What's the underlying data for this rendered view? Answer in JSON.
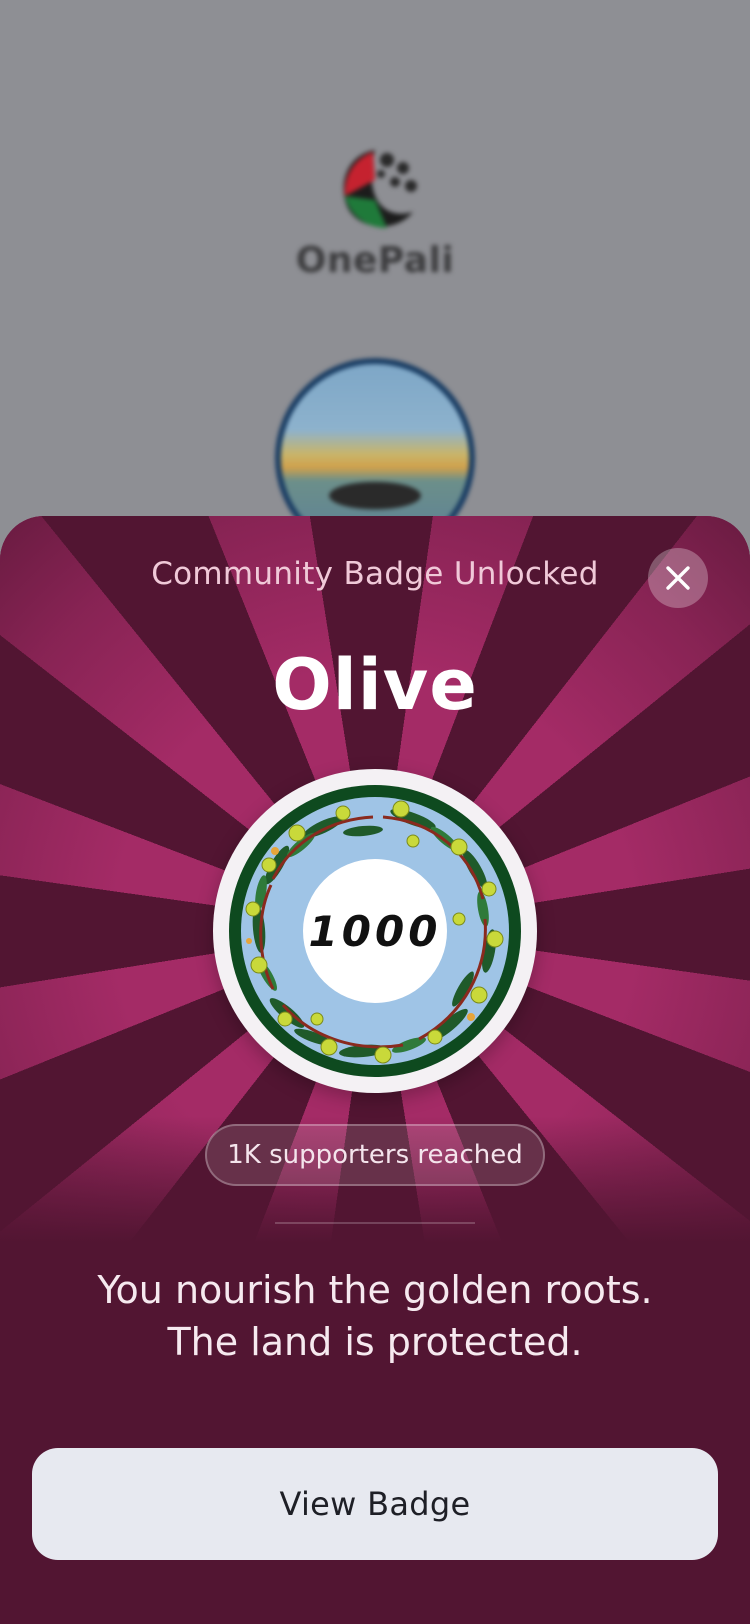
{
  "background": {
    "app_name": "OnePali"
  },
  "sheet": {
    "title": "Community Badge Unlocked",
    "close_icon": "close-icon",
    "badge": {
      "name": "Olive",
      "number": "1000",
      "milestone": "1K supporters reached"
    },
    "message": {
      "line1": "You nourish the golden roots.",
      "line2": "The land is protected."
    },
    "primary_button": "View Badge"
  },
  "colors": {
    "sheet_bg": "#521532",
    "ray": "#a42b66",
    "button_bg": "#e7e9f0",
    "badge_ring": "#0e4a1f"
  }
}
